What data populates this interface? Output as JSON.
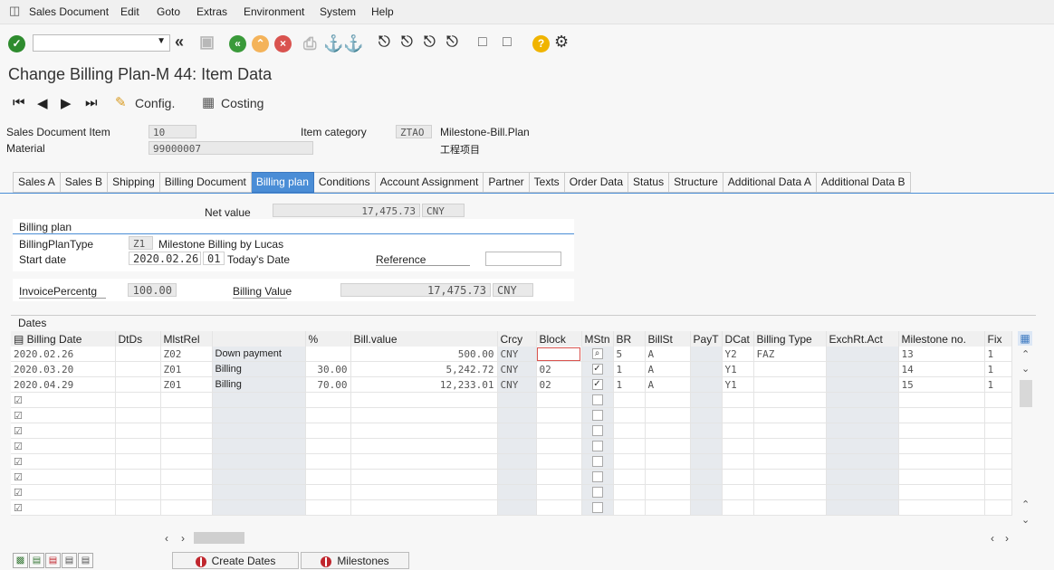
{
  "menu": {
    "items": [
      "Sales Document",
      "Edit",
      "Goto",
      "Extras",
      "Environment",
      "System",
      "Help"
    ]
  },
  "toolbar": {
    "command_value": ""
  },
  "title": "Change Billing Plan-M 44: Item Data",
  "nav": {
    "config_label": "Config.",
    "costing_label": "Costing"
  },
  "header": {
    "sales_doc_item_label": "Sales Document Item",
    "sales_doc_item_value": "10",
    "material_label": "Material",
    "material_value": "99000007",
    "item_category_label": "Item category",
    "item_category_value": "ZTAO",
    "item_category_desc": "Milestone-Bill.Plan",
    "material_desc": "工程项目"
  },
  "tabs": [
    "Sales A",
    "Sales B",
    "Shipping",
    "Billing Document",
    "Billing plan",
    "Conditions",
    "Account Assignment",
    "Partner",
    "Texts",
    "Order Data",
    "Status",
    "Structure",
    "Additional Data A",
    "Additional Data B"
  ],
  "active_tab": "Billing plan",
  "billing": {
    "net_value_label": "Net value",
    "net_value": "17,475.73",
    "net_currency": "CNY",
    "section_title": "Billing plan",
    "plan_type_label": "BillingPlanType",
    "plan_type_code": "Z1",
    "plan_type_desc": "Milestone Billing by Lucas",
    "start_date_label": "Start date",
    "start_date_value": "2020.02.26",
    "start_date_rule": "01",
    "start_date_desc": "Today's Date",
    "reference_label": "Reference",
    "invoice_pct_label": "InvoicePercentg",
    "invoice_pct_value": "100.00",
    "billing_value_label": "Billing Value",
    "billing_value": "17,475.73",
    "billing_currency": "CNY"
  },
  "dates": {
    "section_title": "Dates",
    "columns": [
      "Billing Date",
      "DtDs",
      "MlstRel",
      "",
      "%",
      "Bill.value",
      "Crcy",
      "Block",
      "MStn",
      "BR",
      "BillSt",
      "PayT",
      "DCat",
      "Billing Type",
      "ExchRt.Act",
      "Milestone no.",
      "Fix"
    ],
    "rows": [
      {
        "date": "2020.02.26",
        "dtds": "",
        "mlst": "Z02",
        "desc": "Down payment",
        "pct": "",
        "value": "500.00",
        "crcy": "CNY",
        "block": "",
        "mstn": false,
        "br": "5",
        "billst": "A",
        "payt": "",
        "dcat": "Y2",
        "btype": "FAZ",
        "exch": "",
        "milestone": "13",
        "fix": "1"
      },
      {
        "date": "2020.03.20",
        "dtds": "",
        "mlst": "Z01",
        "desc": "Billing",
        "pct": "30.00",
        "value": "5,242.72",
        "crcy": "CNY",
        "block": "02",
        "mstn": true,
        "br": "1",
        "billst": "A",
        "payt": "",
        "dcat": "Y1",
        "btype": "",
        "exch": "",
        "milestone": "14",
        "fix": "1"
      },
      {
        "date": "2020.04.29",
        "dtds": "",
        "mlst": "Z01",
        "desc": "Billing",
        "pct": "70.00",
        "value": "12,233.01",
        "crcy": "CNY",
        "block": "02",
        "mstn": true,
        "br": "1",
        "billst": "A",
        "payt": "",
        "dcat": "Y1",
        "btype": "",
        "exch": "",
        "milestone": "15",
        "fix": "1"
      }
    ],
    "empty_rows": 8
  },
  "buttons": {
    "create_dates": "Create Dates",
    "milestones": "Milestones"
  },
  "colors": {
    "accent": "#4a8dd6",
    "ok_green": "#2e8b2e",
    "nav_green": "#3a9a3a",
    "cancel_red": "#d9534f",
    "help_yellow": "#f0b400"
  }
}
